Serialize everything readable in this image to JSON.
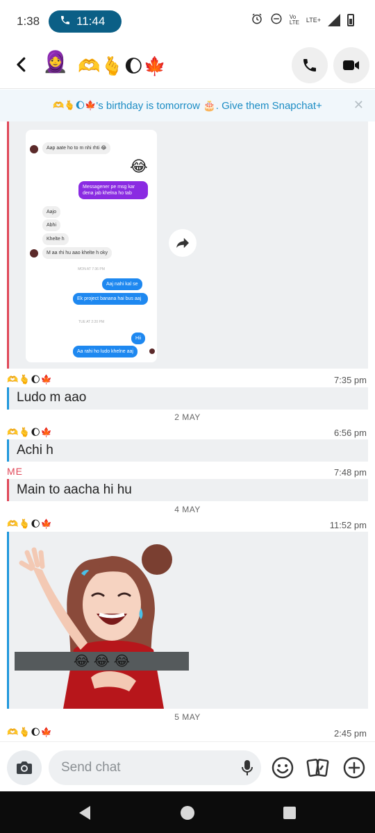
{
  "status_bar": {
    "time": "1:38",
    "call_duration": "11:44",
    "network_small_top": "Vo",
    "network_small_bottom": "LTE",
    "lte_label": "LTE+"
  },
  "header": {
    "name": "🫶🫰🌔🍁",
    "avatar_emoji": "🧕"
  },
  "banner": {
    "emoji_prefix": "🫶🫰🌔🍁",
    "text": "'s birthday is tomorrow 🎂. Give them Snapchat+"
  },
  "screenshot": {
    "messages": [
      {
        "type": "in",
        "text": "Aap aate ho to m nhi rhti 😂"
      },
      {
        "type": "emoji",
        "text": "😂"
      },
      {
        "type": "purple",
        "text": "Messagener pe msg kar dena jab khelna ho tab"
      },
      {
        "type": "in",
        "text": "Aajo"
      },
      {
        "type": "in",
        "text": "Abhi"
      },
      {
        "type": "in",
        "text": "Khelte h"
      },
      {
        "type": "in",
        "text": "M aa rhi hu aao khelte h oky"
      },
      {
        "type": "out",
        "text": "Aaj nahi kal se"
      },
      {
        "type": "out",
        "text": "Ek project banana hai bus aaj"
      },
      {
        "type": "out",
        "text": "Hii"
      },
      {
        "type": "out",
        "text": "Aa rahi ho ludo khelne aaj"
      }
    ],
    "time1": "MON AT 7:36 PM",
    "time2": "TUE AT 2:20 PM"
  },
  "chat": {
    "sender_name": "🫶🫰🌔🍁",
    "me_label": "ME",
    "entries": [
      {
        "time": "7:35 pm",
        "text": "Ludo m aao"
      },
      {
        "date": "2 MAY"
      },
      {
        "time": "6:56 pm",
        "text": "Achi h"
      },
      {
        "time": "7:48 pm",
        "text": "Main to aacha hi hu"
      },
      {
        "date": "4 MAY"
      },
      {
        "time": "11:52 pm"
      },
      {
        "date": "5 MAY"
      },
      {
        "time": "2:45 pm"
      }
    ],
    "sticker_caption": "😂 😂 😂"
  },
  "composer": {
    "placeholder": "Send chat"
  },
  "colors": {
    "accent_blue": "#1e97dc",
    "me_red": "#e04758",
    "call_pill": "#0b5f86"
  }
}
